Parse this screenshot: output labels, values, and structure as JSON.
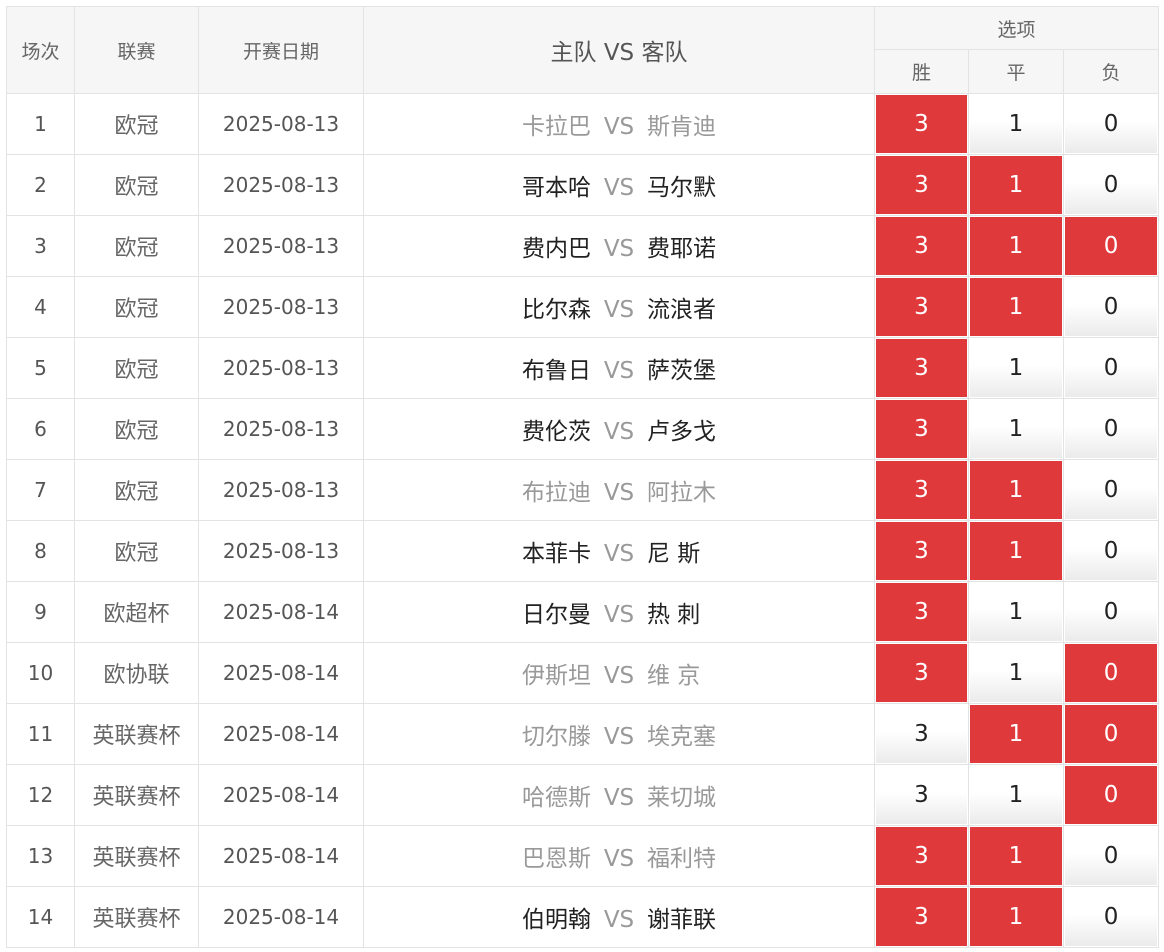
{
  "header": {
    "col_round": "场次",
    "col_league": "联赛",
    "col_date": "开赛日期",
    "col_match": "主队 VS 客队",
    "col_options": "选项",
    "opt_win": "胜",
    "opt_draw": "平",
    "opt_lose": "负"
  },
  "vs_label": "VS",
  "colors": {
    "selected": "#e0393c",
    "selected_text": "#ffffff"
  },
  "rows": [
    {
      "no": "1",
      "league": "欧冠",
      "date": "2025-08-13",
      "home": "卡拉巴",
      "away": "斯肯迪",
      "home_hl": false,
      "away_hl": false,
      "w": "3",
      "d": "1",
      "l": "0",
      "w_sel": true,
      "d_sel": false,
      "l_sel": false
    },
    {
      "no": "2",
      "league": "欧冠",
      "date": "2025-08-13",
      "home": "哥本哈",
      "away": "马尔默",
      "home_hl": true,
      "away_hl": true,
      "w": "3",
      "d": "1",
      "l": "0",
      "w_sel": true,
      "d_sel": true,
      "l_sel": false
    },
    {
      "no": "3",
      "league": "欧冠",
      "date": "2025-08-13",
      "home": "费内巴",
      "away": "费耶诺",
      "home_hl": true,
      "away_hl": true,
      "w": "3",
      "d": "1",
      "l": "0",
      "w_sel": true,
      "d_sel": true,
      "l_sel": true
    },
    {
      "no": "4",
      "league": "欧冠",
      "date": "2025-08-13",
      "home": "比尔森",
      "away": "流浪者",
      "home_hl": true,
      "away_hl": true,
      "w": "3",
      "d": "1",
      "l": "0",
      "w_sel": true,
      "d_sel": true,
      "l_sel": false
    },
    {
      "no": "5",
      "league": "欧冠",
      "date": "2025-08-13",
      "home": "布鲁日",
      "away": "萨茨堡",
      "home_hl": true,
      "away_hl": true,
      "w": "3",
      "d": "1",
      "l": "0",
      "w_sel": true,
      "d_sel": false,
      "l_sel": false
    },
    {
      "no": "6",
      "league": "欧冠",
      "date": "2025-08-13",
      "home": "费伦茨",
      "away": "卢多戈",
      "home_hl": true,
      "away_hl": true,
      "w": "3",
      "d": "1",
      "l": "0",
      "w_sel": true,
      "d_sel": false,
      "l_sel": false
    },
    {
      "no": "7",
      "league": "欧冠",
      "date": "2025-08-13",
      "home": "布拉迪",
      "away": "阿拉木",
      "home_hl": false,
      "away_hl": false,
      "w": "3",
      "d": "1",
      "l": "0",
      "w_sel": true,
      "d_sel": true,
      "l_sel": false
    },
    {
      "no": "8",
      "league": "欧冠",
      "date": "2025-08-13",
      "home": "本菲卡",
      "away": "尼 斯",
      "home_hl": true,
      "away_hl": true,
      "w": "3",
      "d": "1",
      "l": "0",
      "w_sel": true,
      "d_sel": true,
      "l_sel": false
    },
    {
      "no": "9",
      "league": "欧超杯",
      "date": "2025-08-14",
      "home": "日尔曼",
      "away": "热 刺",
      "home_hl": true,
      "away_hl": true,
      "w": "3",
      "d": "1",
      "l": "0",
      "w_sel": true,
      "d_sel": false,
      "l_sel": false
    },
    {
      "no": "10",
      "league": "欧协联",
      "date": "2025-08-14",
      "home": "伊斯坦",
      "away": "维 京",
      "home_hl": false,
      "away_hl": false,
      "w": "3",
      "d": "1",
      "l": "0",
      "w_sel": true,
      "d_sel": false,
      "l_sel": true
    },
    {
      "no": "11",
      "league": "英联赛杯",
      "date": "2025-08-14",
      "home": "切尔滕",
      "away": "埃克塞",
      "home_hl": false,
      "away_hl": false,
      "w": "3",
      "d": "1",
      "l": "0",
      "w_sel": false,
      "d_sel": true,
      "l_sel": true
    },
    {
      "no": "12",
      "league": "英联赛杯",
      "date": "2025-08-14",
      "home": "哈德斯",
      "away": "莱切城",
      "home_hl": false,
      "away_hl": false,
      "w": "3",
      "d": "1",
      "l": "0",
      "w_sel": false,
      "d_sel": false,
      "l_sel": true
    },
    {
      "no": "13",
      "league": "英联赛杯",
      "date": "2025-08-14",
      "home": "巴恩斯",
      "away": "福利特",
      "home_hl": false,
      "away_hl": false,
      "w": "3",
      "d": "1",
      "l": "0",
      "w_sel": true,
      "d_sel": true,
      "l_sel": false
    },
    {
      "no": "14",
      "league": "英联赛杯",
      "date": "2025-08-14",
      "home": "伯明翰",
      "away": "谢菲联",
      "home_hl": true,
      "away_hl": true,
      "w": "3",
      "d": "1",
      "l": "0",
      "w_sel": true,
      "d_sel": true,
      "l_sel": false
    }
  ]
}
